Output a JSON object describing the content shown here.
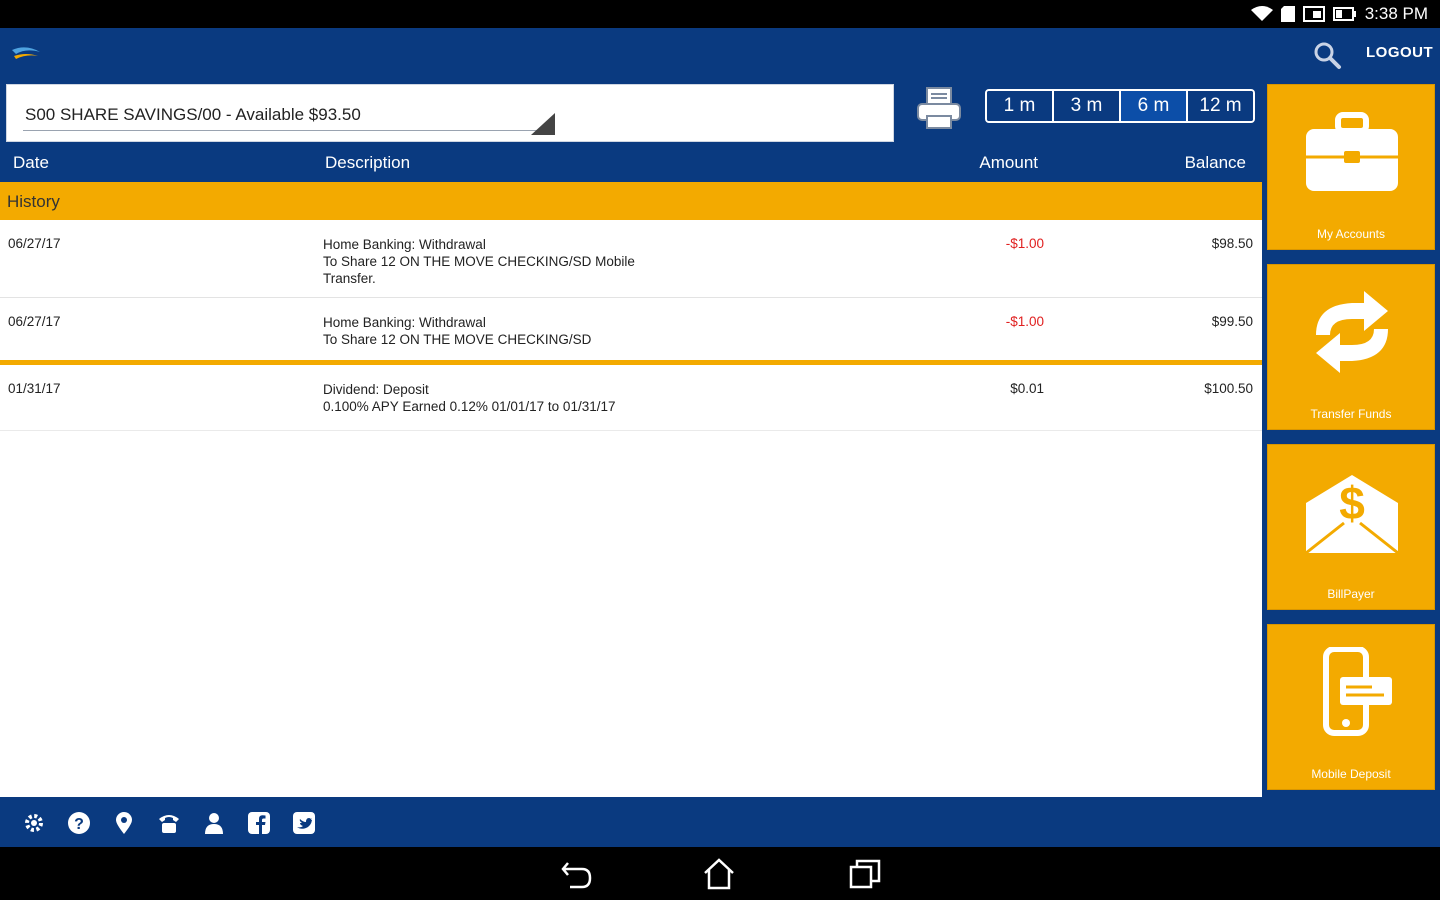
{
  "status_bar": {
    "time": "3:38 PM"
  },
  "header": {
    "logout_label": "LOGOUT"
  },
  "account_selector": {
    "selected": "S00 SHARE SAVINGS/00 - Available $93.50"
  },
  "periods": [
    {
      "label": "1 m",
      "active": false
    },
    {
      "label": "3 m",
      "active": false
    },
    {
      "label": "6 m",
      "active": true
    },
    {
      "label": "12 m",
      "active": false
    }
  ],
  "columns": {
    "date": "Date",
    "description": "Description",
    "amount": "Amount",
    "balance": "Balance"
  },
  "section_label": "History",
  "transactions": [
    {
      "date": "06/27/17",
      "description_lines": [
        "Home Banking: Withdrawal",
        "To Share 12 ON THE MOVE CHECKING/SD   Mobile",
        "Transfer."
      ],
      "amount": "-$1.00",
      "balance": "$98.50"
    },
    {
      "date": "06/27/17",
      "description_lines": [
        "Home Banking: Withdrawal",
        "To Share 12 ON THE MOVE CHECKING/SD"
      ],
      "amount": "-$1.00",
      "balance": "$99.50"
    },
    {
      "date": "01/31/17",
      "description_lines": [
        "Dividend: Deposit",
        "0.100% APY Earned  0.12% 01/01/17 to 01/31/17"
      ],
      "amount": "$0.01",
      "balance": "$100.50"
    }
  ],
  "side_menu": [
    {
      "label": "My Accounts",
      "icon": "briefcase-icon"
    },
    {
      "label": "Transfer Funds",
      "icon": "transfer-arrows-icon"
    },
    {
      "label": "BillPayer",
      "icon": "dollar-envelope-icon"
    },
    {
      "label": "Mobile Deposit",
      "icon": "mobile-deposit-icon"
    }
  ],
  "footer_icons": [
    "settings-icon",
    "help-icon",
    "location-icon",
    "phone-icon",
    "user-icon",
    "facebook-icon",
    "twitter-icon"
  ],
  "colors": {
    "primary_blue": "#0a3a80",
    "accent_orange": "#f3aa00",
    "negative_red": "#e02020"
  }
}
